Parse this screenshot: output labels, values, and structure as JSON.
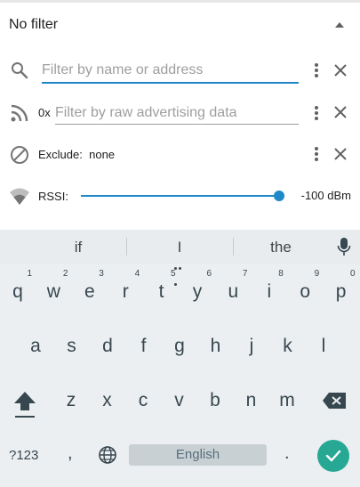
{
  "header": {
    "title": "No filter"
  },
  "filters": {
    "name": {
      "placeholder": "Filter by name or address"
    },
    "raw": {
      "prefix": "0x",
      "placeholder": "Filter by raw advertising data"
    },
    "exclude": {
      "label": "Exclude:",
      "value": "none"
    },
    "rssi": {
      "label": "RSSI:",
      "value": "-100 dBm",
      "slider_fraction": 1.0
    }
  },
  "keyboard": {
    "suggestions": [
      "if",
      "I",
      "the"
    ],
    "row1": [
      {
        "key": "q",
        "num": "1"
      },
      {
        "key": "w",
        "num": "2"
      },
      {
        "key": "e",
        "num": "3"
      },
      {
        "key": "r",
        "num": "4"
      },
      {
        "key": "t",
        "num": "5"
      },
      {
        "key": "y",
        "num": "6"
      },
      {
        "key": "u",
        "num": "7"
      },
      {
        "key": "i",
        "num": "8"
      },
      {
        "key": "o",
        "num": "9"
      },
      {
        "key": "p",
        "num": "0"
      }
    ],
    "row2": [
      "a",
      "s",
      "d",
      "f",
      "g",
      "h",
      "j",
      "k",
      "l"
    ],
    "row3": [
      "z",
      "x",
      "c",
      "v",
      "b",
      "n",
      "m"
    ],
    "bottom": {
      "symbols": "?123",
      "comma": ",",
      "space": "English",
      "period": "."
    }
  },
  "colors": {
    "accent": "#1e88c8",
    "enter": "#27a894",
    "keyboard_bg": "#eceff1"
  }
}
